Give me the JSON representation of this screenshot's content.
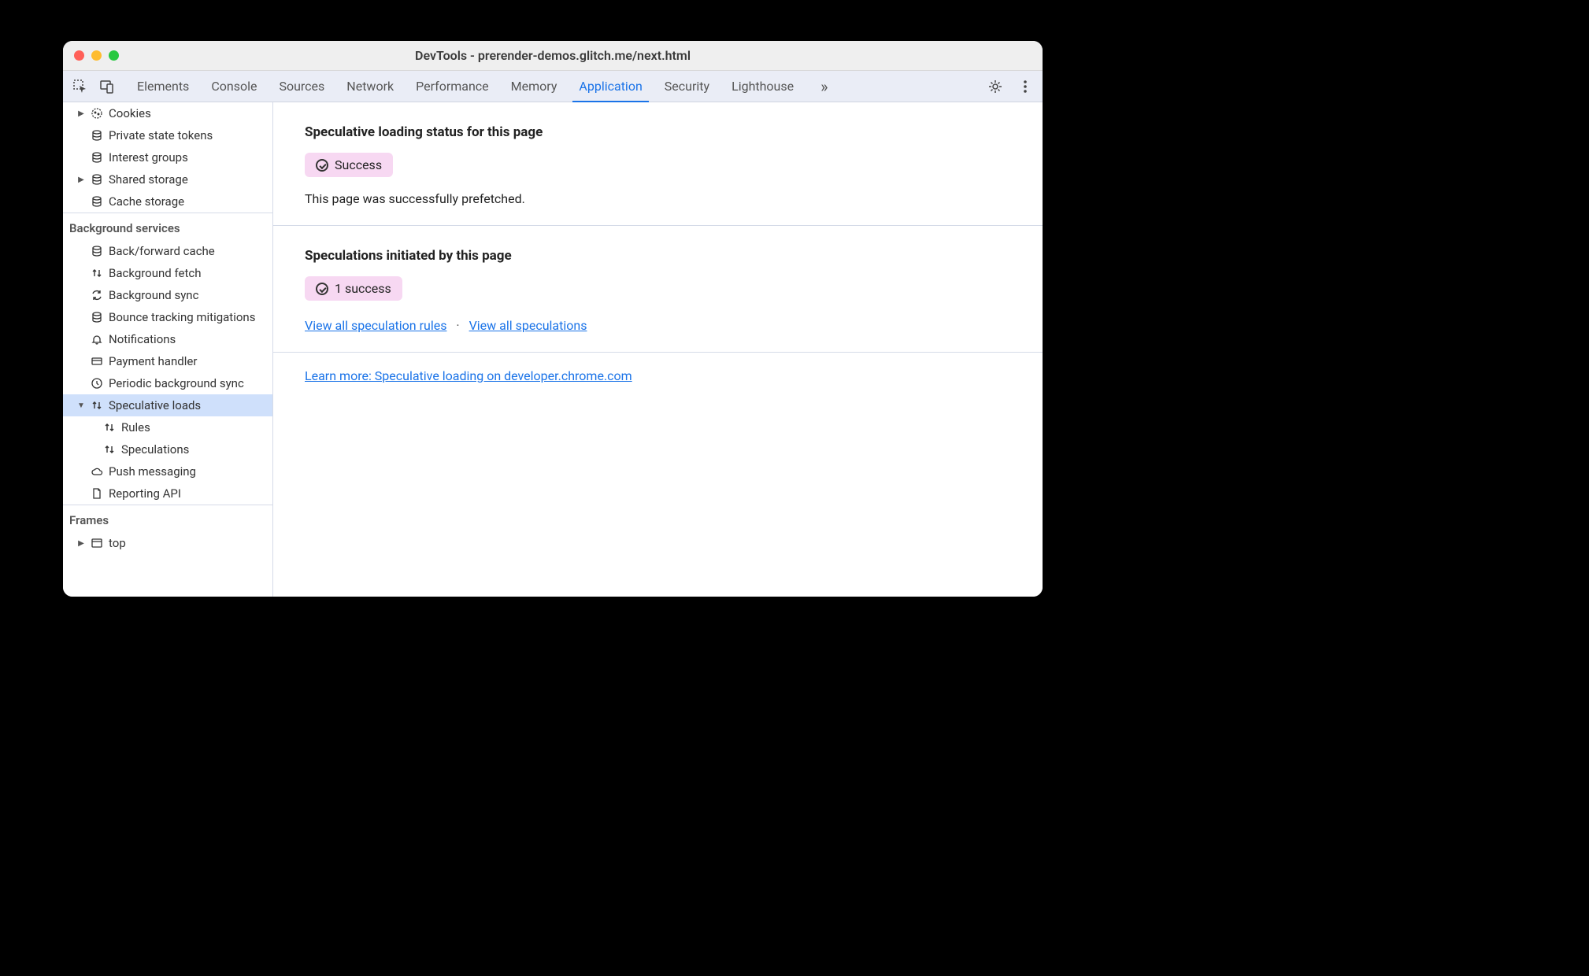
{
  "window_title": "DevTools - prerender-demos.glitch.me/next.html",
  "tabs": [
    "Elements",
    "Console",
    "Sources",
    "Network",
    "Performance",
    "Memory",
    "Application",
    "Security",
    "Lighthouse"
  ],
  "active_tab": "Application",
  "sidebar": {
    "storage_items": [
      {
        "label": "Cookies",
        "icon": "cookie",
        "disclosure": "right"
      },
      {
        "label": "Private state tokens",
        "icon": "db",
        "disclosure": ""
      },
      {
        "label": "Interest groups",
        "icon": "db",
        "disclosure": ""
      },
      {
        "label": "Shared storage",
        "icon": "db",
        "disclosure": "right"
      },
      {
        "label": "Cache storage",
        "icon": "db",
        "disclosure": ""
      }
    ],
    "background_header": "Background services",
    "background_items": [
      {
        "label": "Back/forward cache",
        "icon": "db"
      },
      {
        "label": "Background fetch",
        "icon": "updown"
      },
      {
        "label": "Background sync",
        "icon": "sync"
      },
      {
        "label": "Bounce tracking mitigations",
        "icon": "db"
      },
      {
        "label": "Notifications",
        "icon": "bell"
      },
      {
        "label": "Payment handler",
        "icon": "card"
      },
      {
        "label": "Periodic background sync",
        "icon": "clock"
      },
      {
        "label": "Speculative loads",
        "icon": "updown",
        "selected": true,
        "disclosure": "down",
        "children": [
          {
            "label": "Rules",
            "icon": "updown"
          },
          {
            "label": "Speculations",
            "icon": "updown"
          }
        ]
      },
      {
        "label": "Push messaging",
        "icon": "cloud"
      },
      {
        "label": "Reporting API",
        "icon": "doc"
      }
    ],
    "frames_header": "Frames",
    "frames_items": [
      {
        "label": "top",
        "icon": "frame",
        "disclosure": "right"
      }
    ]
  },
  "main": {
    "section1_title": "Speculative loading status for this page",
    "section1_badge": "Success",
    "section1_text": "This page was successfully prefetched.",
    "section2_title": "Speculations initiated by this page",
    "section2_badge": "1 success",
    "link_rules": "View all speculation rules",
    "link_specs": "View all speculations",
    "learn_more": "Learn more: Speculative loading on developer.chrome.com"
  }
}
